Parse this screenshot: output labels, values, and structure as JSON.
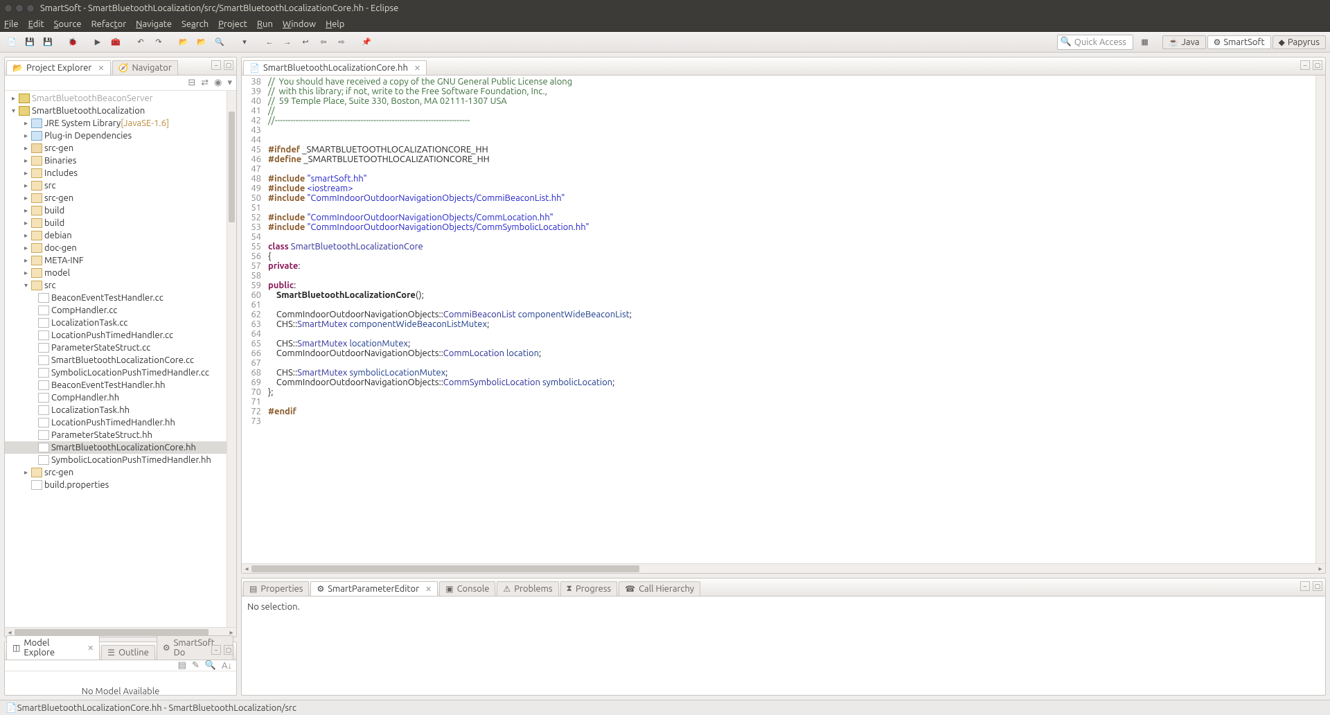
{
  "window": {
    "title": "SmartSoft - SmartBluetoothLocalization/src/SmartBluetoothLocalizationCore.hh - Eclipse"
  },
  "menu": [
    "File",
    "Edit",
    "Source",
    "Refactor",
    "Navigate",
    "Search",
    "Project",
    "Run",
    "Window",
    "Help"
  ],
  "quick_access": "Quick Access",
  "perspectives": [
    "Java",
    "SmartSoft",
    "Papyrus"
  ],
  "left_tabs": {
    "explorer": "Project Explorer",
    "navigator": "Navigator"
  },
  "tree": {
    "cut": "",
    "proj": "SmartBluetoothLocalization",
    "jre": "JRE System Library",
    "jre_lib": "[JavaSE-1.6]",
    "plugin": "Plug-in Dependencies",
    "items": [
      "src-gen",
      "Binaries",
      "Includes",
      "src",
      "src-gen",
      "build",
      "build",
      "debian",
      "doc-gen",
      "META-INF",
      "model"
    ],
    "src": "src",
    "files": [
      "BeaconEventTestHandler.cc",
      "CompHandler.cc",
      "LocalizationTask.cc",
      "LocationPushTimedHandler.cc",
      "ParameterStateStruct.cc",
      "SmartBluetoothLocalizationCore.cc",
      "SymbolicLocationPushTimedHandler.cc",
      "BeaconEventTestHandler.hh",
      "CompHandler.hh",
      "LocalizationTask.hh",
      "LocationPushTimedHandler.hh",
      "ParameterStateStruct.hh",
      "SmartBluetoothLocalizationCore.hh",
      "SymbolicLocationPushTimedHandler.hh"
    ],
    "srcgen2": "src-gen",
    "buildprops": "build.properties"
  },
  "model_view": {
    "tab": "Model Explore",
    "outline": "Outline",
    "smartsoft": "SmartSoft Do",
    "msg": "No Model Available"
  },
  "editor_tab": "SmartBluetoothLocalizationCore.hh",
  "code_lines": {
    "start": 38,
    "end": 73
  },
  "bottom": {
    "tabs": [
      "Properties",
      "SmartParameterEditor",
      "Console",
      "Problems",
      "Progress",
      "Call Hierarchy"
    ],
    "msg": "No selection."
  },
  "status": "SmartBluetoothLocalizationCore.hh - SmartBluetoothLocalization/src",
  "chart_data": null
}
